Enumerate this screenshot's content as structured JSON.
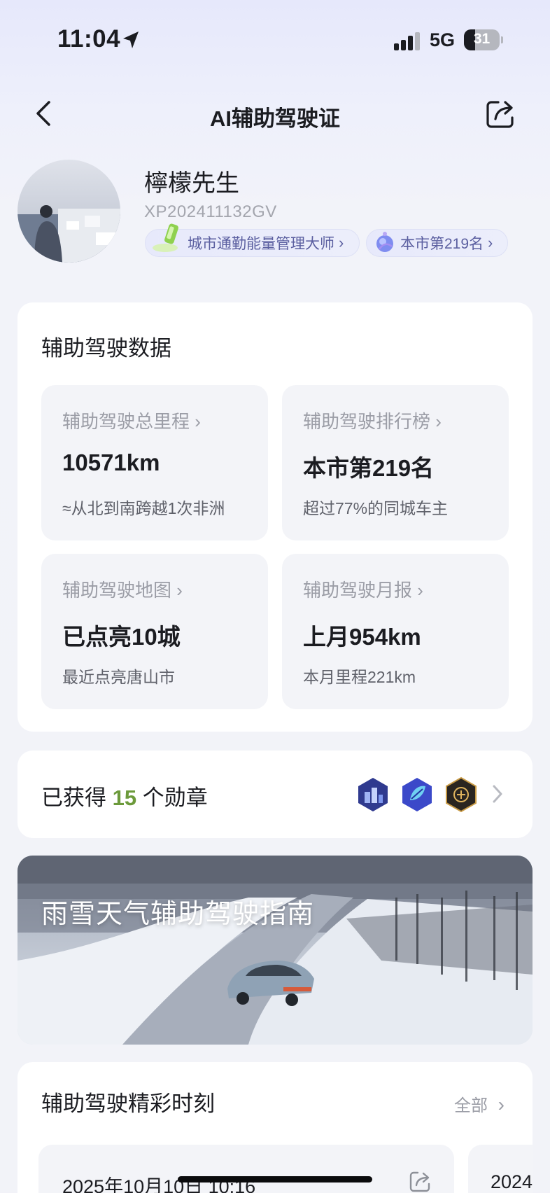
{
  "status_bar": {
    "time": "11:04",
    "network": "5G",
    "battery": "31",
    "battery_level": 0.31
  },
  "nav": {
    "title": "AI辅助驾驶证"
  },
  "profile": {
    "name": "檸檬先生",
    "id": "XP202411132GV",
    "title_badge": "城市通勤能量管理大师",
    "rank_badge": "本市第219名"
  },
  "data_section": {
    "title": "辅助驾驶数据",
    "tiles": [
      {
        "label": "辅助驾驶总里程",
        "value": "10571km",
        "sub": "≈从北到南跨越1次非洲"
      },
      {
        "label": "辅助驾驶排行榜",
        "value": "本市第219名",
        "sub": "超过77%的同城车主"
      },
      {
        "label": "辅助驾驶地图",
        "value": "已点亮10城",
        "sub": "最近点亮唐山市"
      },
      {
        "label": "辅助驾驶月报",
        "value": "上月954km",
        "sub": "本月里程221km"
      }
    ]
  },
  "badges": {
    "prefix": "已获得",
    "count": "15",
    "suffix": "个勋章"
  },
  "banner": {
    "title": "雨雪天气辅助驾驶指南"
  },
  "highlights": {
    "title": "辅助驾驶精彩时刻",
    "see_all": "全部",
    "moments": [
      {
        "date": "2025年10月10日 10:16"
      },
      {
        "date": "2024"
      }
    ]
  },
  "colors": {
    "accent_green": "#6c9a3b",
    "pill_text": "#5b5fa0"
  }
}
